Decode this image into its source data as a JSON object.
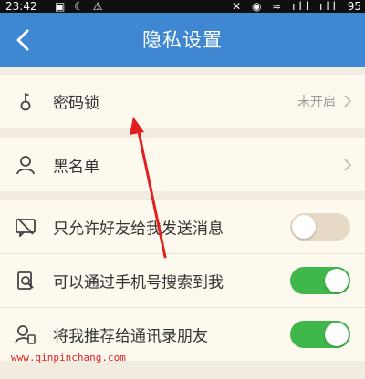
{
  "status_bar": {
    "time": "23:42",
    "left_icons": "▣ ☾ ⚠",
    "right_icons": "✕ ◉ ≈ ıll ıll",
    "battery": "95"
  },
  "header": {
    "title": "隐私设置",
    "back_icon": "chevron-left-icon"
  },
  "sections": {
    "password": {
      "label": "密码锁",
      "value": "未开启"
    },
    "blacklist": {
      "label": "黑名单"
    },
    "messaging": {
      "items": [
        {
          "label": "只允许好友给我发送消息",
          "enabled": false
        },
        {
          "label": "可以通过手机号搜索到我",
          "enabled": true
        },
        {
          "label": "将我推荐给通讯录朋友",
          "enabled": true
        }
      ]
    }
  },
  "watermark": "www.qinpinchang.com",
  "colors": {
    "header": "#3f87d1",
    "toggle_on": "#3fb74a",
    "toggle_off": "#e6d9c5",
    "annotation_arrow": "#e02020"
  }
}
